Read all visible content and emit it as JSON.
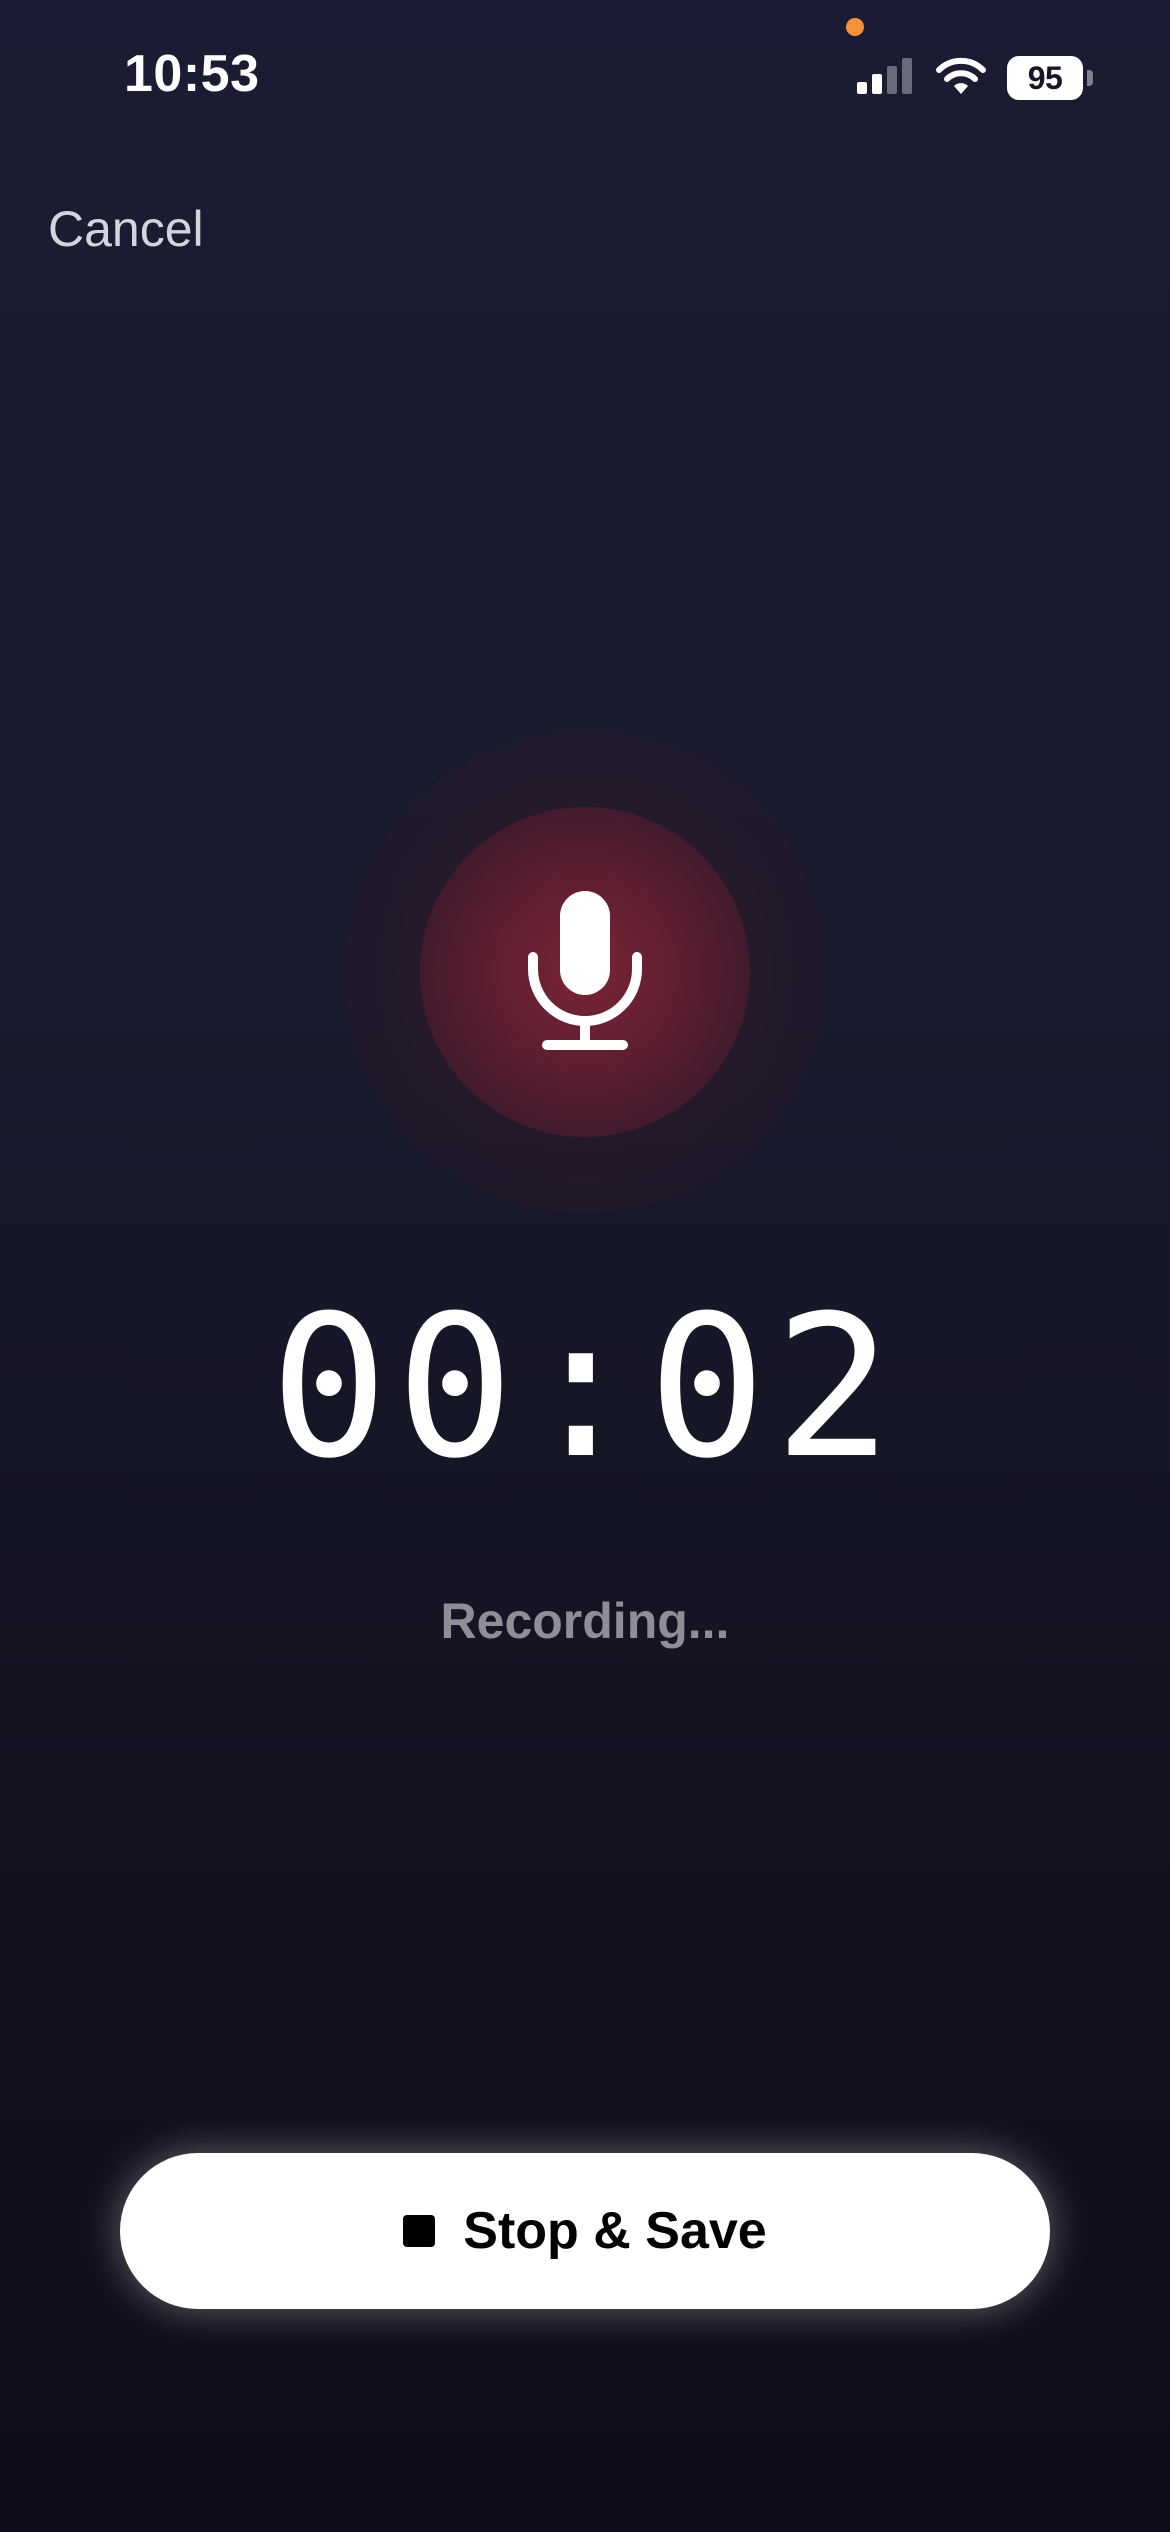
{
  "status_bar": {
    "time": "10:53",
    "battery_level": "95",
    "signal_bars_active": 2,
    "signal_bars_total": 4,
    "privacy_dot_color": "#f5913a"
  },
  "header": {
    "cancel_label": "Cancel"
  },
  "recorder": {
    "mic_icon": "microphone-icon",
    "accent_color": "#7a2434",
    "timer": "00:02",
    "status": "Recording..."
  },
  "actions": {
    "stop_icon": "stop-icon",
    "stop_save_label": "Stop & Save"
  }
}
